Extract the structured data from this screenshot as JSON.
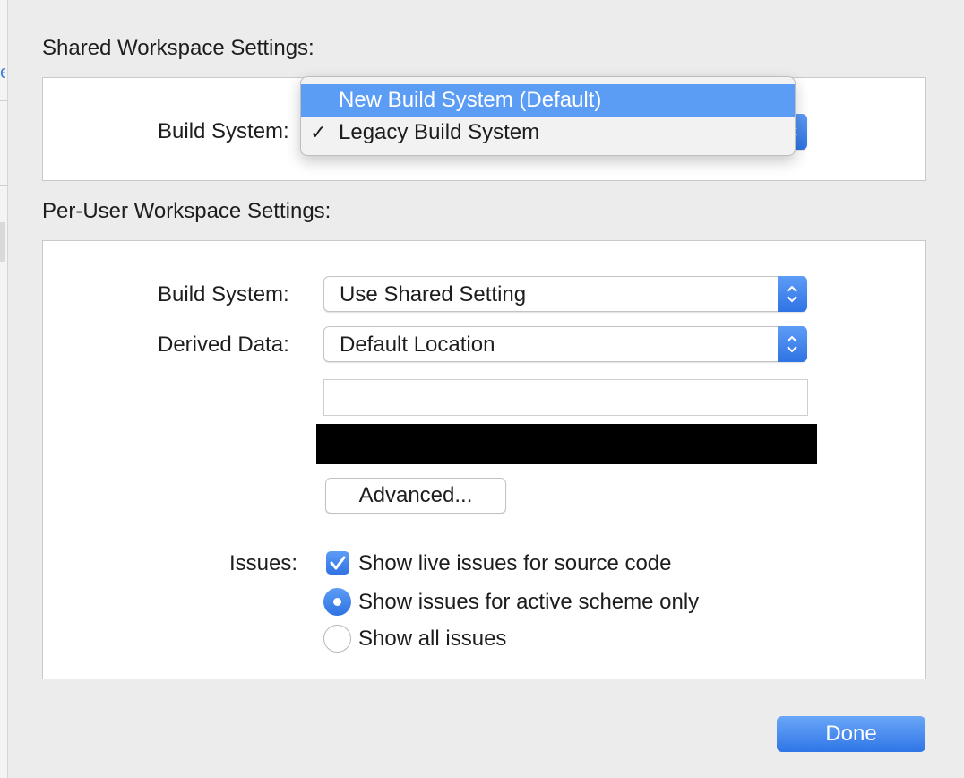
{
  "shared": {
    "title": "Shared Workspace Settings:",
    "build_system_label": "Build System:",
    "build_system_menu": [
      {
        "label": "New Build System (Default)",
        "highlighted": true,
        "checked": false
      },
      {
        "label": "Legacy Build System",
        "highlighted": false,
        "checked": true
      }
    ],
    "check_glyph": "✓"
  },
  "per_user": {
    "title": "Per-User Workspace Settings:",
    "build_system_label": "Build System:",
    "build_system_value": "Use Shared Setting",
    "derived_data_label": "Derived Data:",
    "derived_data_value": "Default Location",
    "derived_data_path": "",
    "advanced_label": "Advanced...",
    "issues_label": "Issues:",
    "live_issues_label": "Show live issues for source code",
    "live_issues_checked": true,
    "radio_active_scheme_label": "Show issues for active scheme only",
    "radio_all_issues_label": "Show all issues",
    "selected_radio": "active_scheme"
  },
  "footer": {
    "done_label": "Done"
  },
  "colors": {
    "accent": "#3b82f0",
    "menu_highlight": "#5b9cf4",
    "redaction": "#000000"
  }
}
